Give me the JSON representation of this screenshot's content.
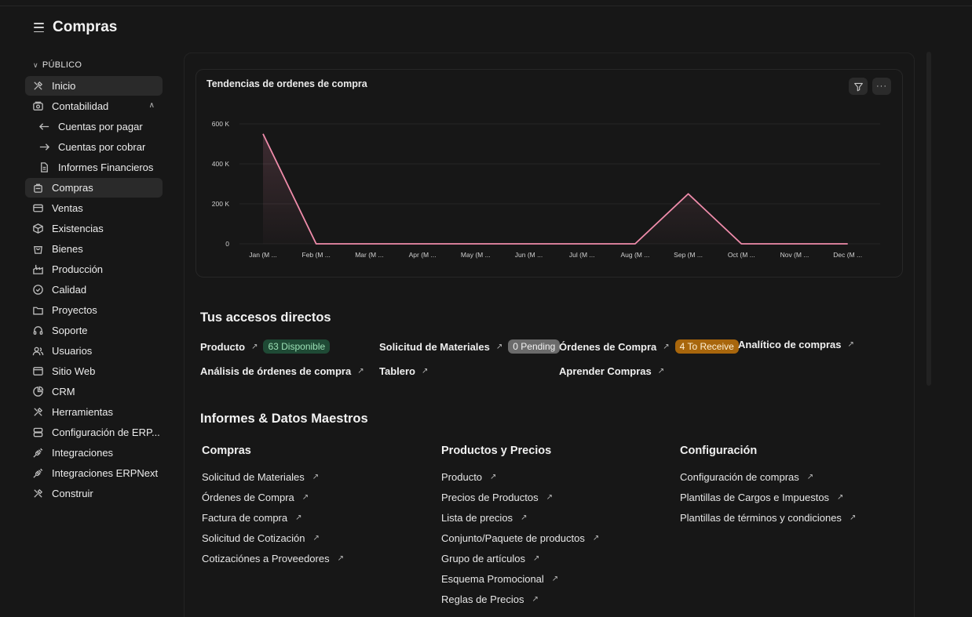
{
  "header": {
    "title": "Compras"
  },
  "sidebar": {
    "section_label": "PÚBLICO",
    "items": [
      {
        "label": "Inicio",
        "icon": "tools-icon",
        "active": true
      },
      {
        "label": "Contabilidad",
        "icon": "money-icon",
        "expanded": true
      },
      {
        "label": "Cuentas por pagar",
        "icon": "arrow-left-icon",
        "sub": true
      },
      {
        "label": "Cuentas por cobrar",
        "icon": "arrow-right-icon",
        "sub": true
      },
      {
        "label": "Informes Financieros",
        "icon": "file-icon",
        "sub": true
      },
      {
        "label": "Compras",
        "icon": "bag-icon",
        "active": true
      },
      {
        "label": "Ventas",
        "icon": "card-icon"
      },
      {
        "label": "Existencias",
        "icon": "box-icon"
      },
      {
        "label": "Bienes",
        "icon": "shopping-bag-icon"
      },
      {
        "label": "Producción",
        "icon": "factory-icon"
      },
      {
        "label": "Calidad",
        "icon": "badge-check-icon"
      },
      {
        "label": "Proyectos",
        "icon": "folder-icon"
      },
      {
        "label": "Soporte",
        "icon": "headset-icon"
      },
      {
        "label": "Usuarios",
        "icon": "users-icon"
      },
      {
        "label": "Sitio Web",
        "icon": "browser-icon"
      },
      {
        "label": "CRM",
        "icon": "pie-icon"
      },
      {
        "label": "Herramientas",
        "icon": "tools-icon"
      },
      {
        "label": "Configuración de ERP...",
        "icon": "database-icon"
      },
      {
        "label": "Integraciones",
        "icon": "plug-icon"
      },
      {
        "label": "Integraciones ERPNext",
        "icon": "plug-icon"
      },
      {
        "label": "Construir",
        "icon": "tools-icon"
      }
    ]
  },
  "chart": {
    "title": "Tendencias de ordenes de compra",
    "filter_icon": "filter-icon",
    "more_icon": "more-icon",
    "line_color": "#f08cab"
  },
  "chart_data": {
    "type": "line",
    "categories": [
      "Jan (M ...",
      "Feb (M ...",
      "Mar (M ...",
      "Apr (M ...",
      "May (M ...",
      "Jun (M ...",
      "Jul (M ...",
      "Aug (M ...",
      "Sep (M ...",
      "Oct (M ...",
      "Nov (M ...",
      "Dec (M ..."
    ],
    "values": [
      550000,
      0,
      0,
      0,
      0,
      0,
      0,
      0,
      250000,
      0,
      0,
      0
    ],
    "yticks": [
      "0",
      "200 K",
      "400 K",
      "600 K"
    ],
    "ylim": [
      0,
      600000
    ],
    "grid": true
  },
  "shortcuts": {
    "title": "Tus accesos directos",
    "items": [
      {
        "label": "Producto",
        "badge": "63 Disponible",
        "badge_bg": "#1f4a35",
        "badge_fg": "#9be0b5"
      },
      {
        "label": "Solicitud de Materiales",
        "badge": "0 Pending",
        "badge_bg": "#6b6b6b",
        "badge_fg": "#f2f2f2"
      },
      {
        "label": "Órdenes de Compra",
        "badge": "4 To Receive",
        "badge_bg": "#a8660c",
        "badge_fg": "#fff1d6"
      },
      {
        "label": "Analítico de compras"
      },
      {
        "label": "Análisis de órdenes de compra"
      },
      {
        "label": "Tablero"
      },
      {
        "label": "Aprender Compras"
      }
    ]
  },
  "reports": {
    "title": "Informes & Datos Maestros",
    "columns": [
      {
        "title": "Compras",
        "links": [
          "Solicitud de Materiales",
          "Órdenes de Compra",
          "Factura de compra",
          "Solicitud de Cotización",
          "Cotizaciónes a Proveedores"
        ]
      },
      {
        "title": "Productos y Precios",
        "links": [
          "Producto",
          "Precios de Productos",
          "Lista de precios",
          "Conjunto/Paquete de productos",
          "Grupo de artículos",
          "Esquema Promocional",
          "Reglas de Precios"
        ]
      },
      {
        "title": "Configuración",
        "links": [
          "Configuración de compras",
          "Plantillas de Cargos e Impuestos",
          "Plantillas de términos y condiciones"
        ]
      }
    ]
  }
}
